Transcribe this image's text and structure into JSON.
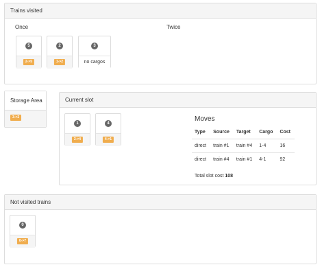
{
  "trains_visited": {
    "title": "Trains visited",
    "once_label": "Once",
    "twice_label": "Twice",
    "cards": [
      {
        "num": "5",
        "badge": "2->5"
      },
      {
        "num": "2",
        "badge": "1->2"
      },
      {
        "num": "3",
        "note": "no cargos"
      }
    ]
  },
  "storage": {
    "title": "Storage Area",
    "badge": "3->2"
  },
  "current_slot": {
    "title": "Current slot",
    "cards": [
      {
        "num": "1",
        "badge": "3->4"
      },
      {
        "num": "4",
        "badge": "4->1"
      }
    ],
    "moves_title": "Moves",
    "columns": [
      "Type",
      "Source",
      "Target",
      "Cargo",
      "Cost"
    ],
    "rows": [
      [
        "direct",
        "train #1",
        "train #4",
        "1-4",
        "16"
      ],
      [
        "direct",
        "train #4",
        "train #1",
        "4-1",
        "92"
      ]
    ],
    "total_label": "Total slot cost",
    "total_value": "108"
  },
  "not_visited": {
    "title": "Not visited trains",
    "cards": [
      {
        "num": "0",
        "badge": "0->7"
      }
    ]
  },
  "colors": {
    "badge": "#f0ad4e",
    "circle": "#666666",
    "heading_bg": "#f5f5f5",
    "border": "#dddddd"
  }
}
